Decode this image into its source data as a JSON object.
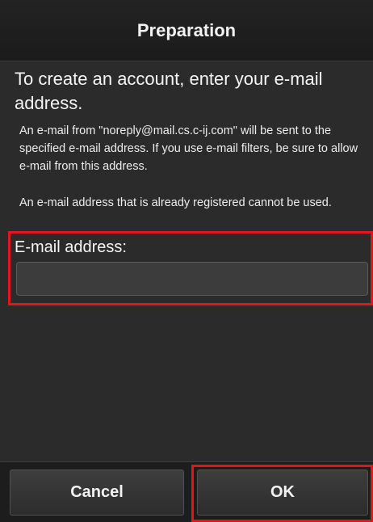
{
  "header": {
    "title": "Preparation"
  },
  "content": {
    "intro": "To create an account, enter your e-mail address.",
    "note_1": "An e-mail from \"noreply@mail.cs.c-ij.com\" will be sent to the specified e-mail address. If you use e-mail filters, be sure to allow e-mail from this address.",
    "note_2": "An e-mail address that is already registered cannot be used."
  },
  "email": {
    "label": "E-mail address:",
    "value": "",
    "placeholder": ""
  },
  "footer": {
    "cancel_label": "Cancel",
    "ok_label": "OK"
  },
  "colors": {
    "highlight": "#e2141f",
    "background": "#2b2b2b",
    "header": "#1b1b1b"
  }
}
